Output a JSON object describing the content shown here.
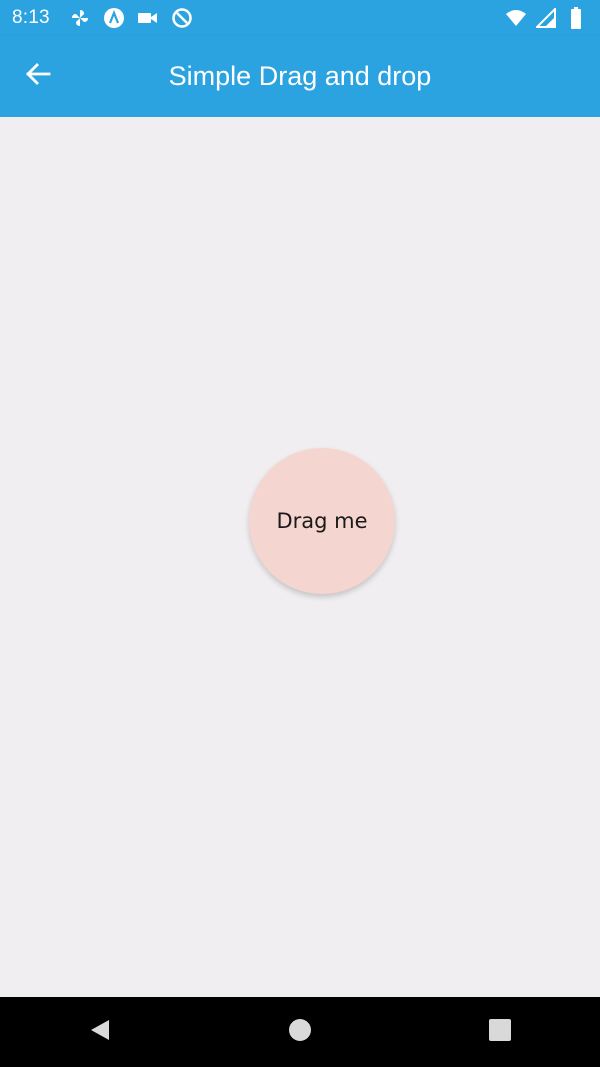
{
  "status_bar": {
    "time": "8:13",
    "left_icons": [
      "pinwheel-icon",
      "android-studio-icon",
      "video-camera-icon",
      "data-saver-icon"
    ],
    "right_icons": [
      "wifi-icon",
      "cell-signal-icon",
      "battery-icon"
    ]
  },
  "app_bar": {
    "title": "Simple Drag and drop",
    "back_icon": "arrow-back-icon"
  },
  "main": {
    "draggable_label": "Drag me"
  },
  "nav_bar": {
    "buttons": [
      "back-triangle-icon",
      "home-circle-icon",
      "recents-square-icon"
    ]
  },
  "colors": {
    "app_bar": "#2aa3e0",
    "background": "#f0eef0",
    "circle": "#f5d5cf",
    "nav_bar": "#000000"
  }
}
